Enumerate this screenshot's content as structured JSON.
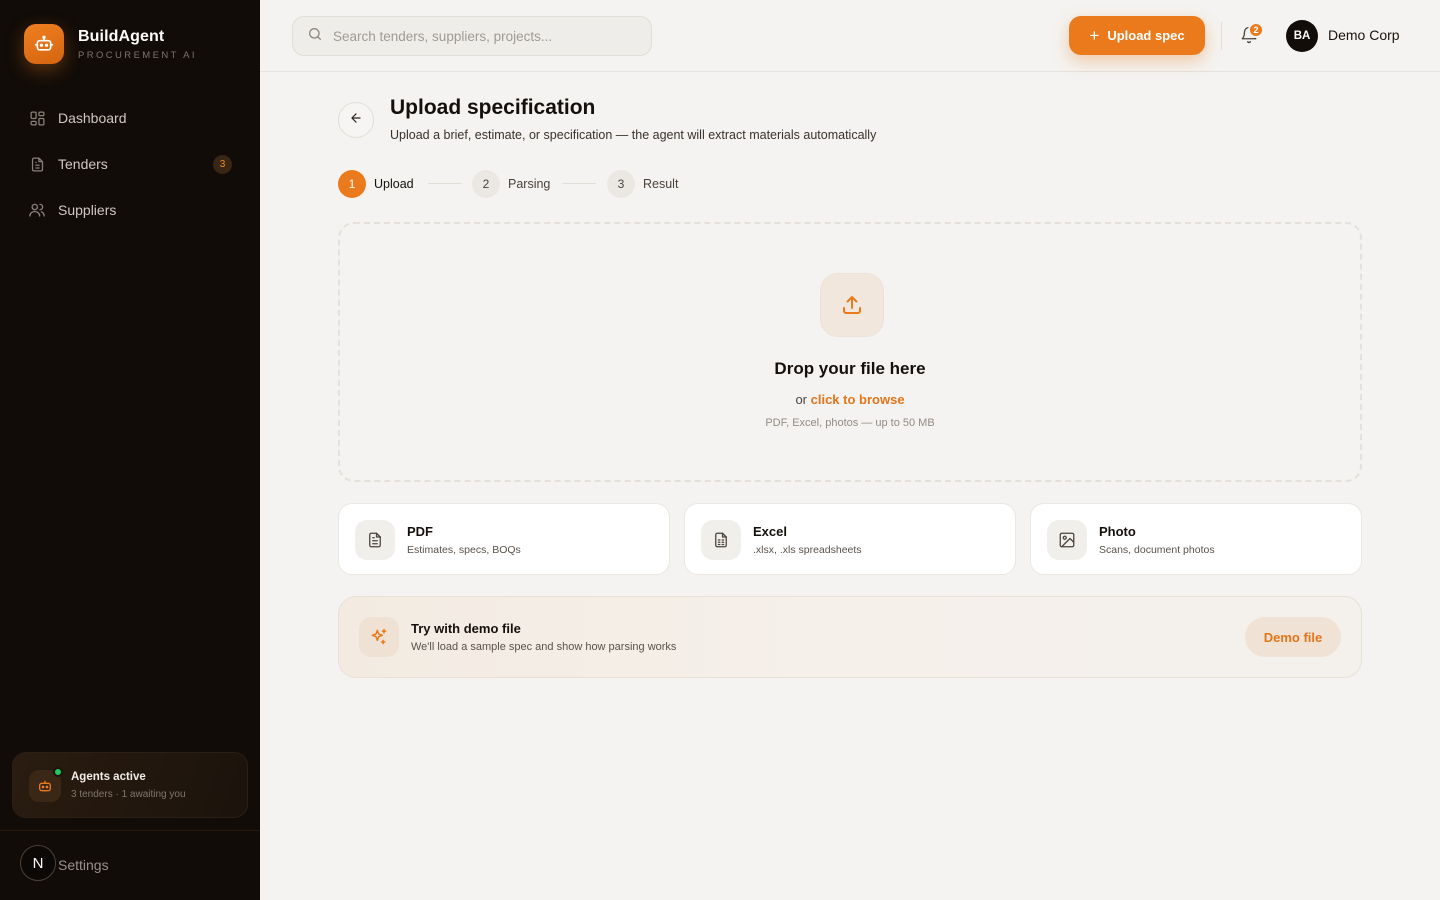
{
  "brand": {
    "name": "BuildAgent",
    "subtitle": "PROCUREMENT AI"
  },
  "sidebar": {
    "items": [
      {
        "label": "Dashboard",
        "icon": "dashboard-icon"
      },
      {
        "label": "Tenders",
        "icon": "document-icon",
        "badge": "3"
      },
      {
        "label": "Suppliers",
        "icon": "users-icon"
      }
    ],
    "agents": {
      "title": "Agents active",
      "subtitle": "3 tenders · 1 awaiting you",
      "status_color": "#22c55e"
    },
    "footer": {
      "avatar_letter": "N",
      "settings_label": "Settings"
    }
  },
  "topbar": {
    "search_placeholder": "Search tenders, suppliers, projects...",
    "upload_label": "Upload spec",
    "notification_count": "2",
    "user_initials": "BA",
    "user_name": "Demo Corp"
  },
  "page": {
    "title": "Upload specification",
    "subtitle": "Upload a brief, estimate, or specification — the agent will extract materials automatically"
  },
  "steps": [
    {
      "number": "1",
      "label": "Upload",
      "active": true
    },
    {
      "number": "2",
      "label": "Parsing",
      "active": false
    },
    {
      "number": "3",
      "label": "Result",
      "active": false
    }
  ],
  "dropzone": {
    "title": "Drop your file here",
    "or_text": "or",
    "browse_link": "click to browse",
    "hint": "PDF, Excel, photos — up to 50 MB"
  },
  "file_types": [
    {
      "title": "PDF",
      "subtitle": "Estimates, specs, BOQs",
      "icon": "pdf-file-icon"
    },
    {
      "title": "Excel",
      "subtitle": ".xlsx, .xls spreadsheets",
      "icon": "spreadsheet-file-icon"
    },
    {
      "title": "Photo",
      "subtitle": "Scans, document photos",
      "icon": "image-icon"
    }
  ],
  "demo": {
    "title": "Try with demo file",
    "subtitle": "We'll load a sample spec and show how parsing works",
    "button_label": "Demo file"
  },
  "colors": {
    "accent": "#ea7a1c",
    "sidebar_bg": "#110c08",
    "page_bg": "#f4f3f1"
  }
}
